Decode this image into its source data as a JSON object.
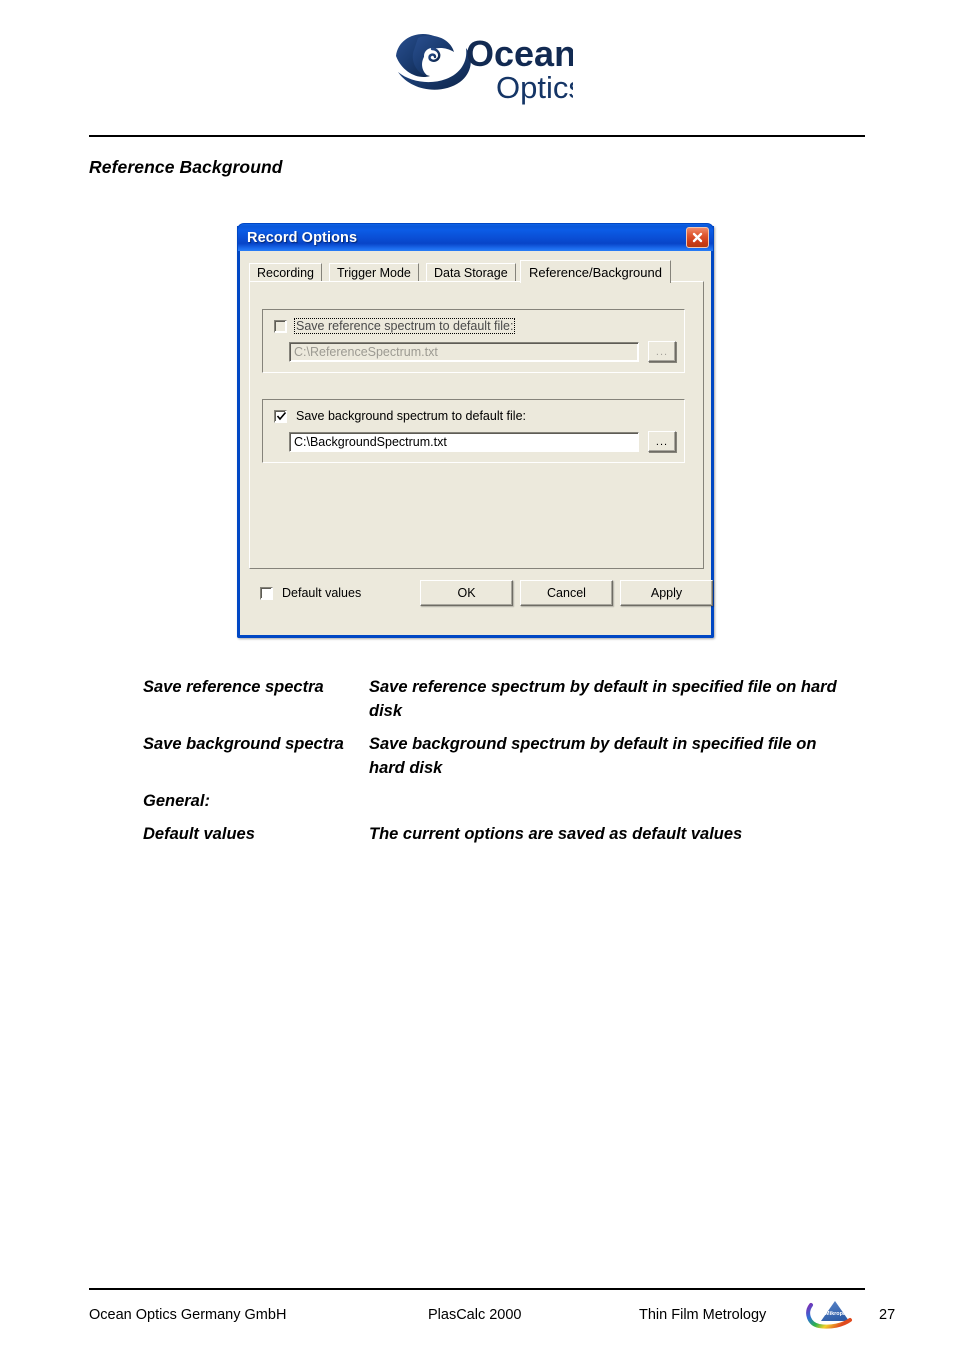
{
  "page": {
    "section_title": "Reference Background",
    "brand_logo_name": "ocean-optics-logo",
    "brand_line1": "Ocean",
    "brand_line2": "Optics"
  },
  "dialog": {
    "title": "Record Options",
    "close_label": "×",
    "tabs": [
      {
        "label": "Recording",
        "active": false
      },
      {
        "label": "Trigger Mode",
        "active": false
      },
      {
        "label": "Data Storage",
        "active": false
      },
      {
        "label": "Reference/Background",
        "active": true
      }
    ],
    "reference_group": {
      "checkbox_label": "Save reference spectrum to default file:",
      "checked": false,
      "enabled": false,
      "focused": true,
      "path_value": "C:\\ReferenceSpectrum.txt",
      "browse_label": "..."
    },
    "background_group": {
      "checkbox_label": "Save background spectrum to default file:",
      "checked": true,
      "enabled": true,
      "focused": false,
      "path_value": "C:\\BackgroundSpectrum.txt",
      "browse_label": "..."
    },
    "footer_controls": {
      "default_values_label": "Default values",
      "default_values_checked": false,
      "ok_label": "OK",
      "cancel_label": "Cancel",
      "apply_label": "Apply"
    }
  },
  "descriptions": [
    {
      "term": "Save reference spectra",
      "definition": "Save reference spectrum by default in specified file on hard disk"
    },
    {
      "term": "Save background spectra",
      "definition": "Save background spectrum by default in specified file on hard disk"
    },
    {
      "term": "General:",
      "definition": ""
    },
    {
      "term": "Default values",
      "definition": "The current options are saved as default values"
    }
  ],
  "footer": {
    "company": "Ocean Optics Germany GmbH",
    "product": "PlasCalc 2000",
    "tagline": "Thin Film Metrology",
    "logo_name": "mikropack-logo",
    "logo_text": "Mikropack",
    "page_number": "27"
  },
  "colors": {
    "titlebar_blue": "#0a57d8",
    "dialog_face": "#ece9dc",
    "dialog_border": "#0047c4",
    "close_red": "#cc3b16",
    "brand_navy": "#183a6b",
    "text_black": "#000000",
    "disabled_gray": "#9c9a92"
  }
}
